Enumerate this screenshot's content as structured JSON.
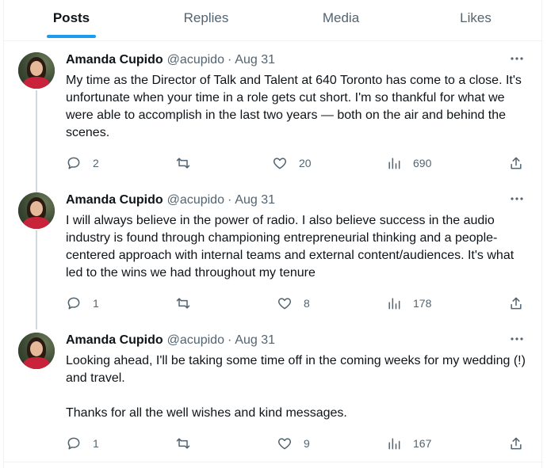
{
  "tabs": [
    {
      "label": "Posts",
      "active": true
    },
    {
      "label": "Replies",
      "active": false
    },
    {
      "label": "Media",
      "active": false
    },
    {
      "label": "Likes",
      "active": false
    }
  ],
  "posts": [
    {
      "author": "Amanda Cupido",
      "handle": "@acupido",
      "date": "Aug 31",
      "text": "My time as the Director of Talk and Talent at 640 Toronto has come to a close. It's unfortunate when your time in a role gets cut short. I'm so thankful for what we were able to accomplish in the last two years — both on the air and behind the scenes.",
      "replies": "2",
      "reposts": "",
      "likes": "20",
      "views": "690"
    },
    {
      "author": "Amanda Cupido",
      "handle": "@acupido",
      "date": "Aug 31",
      "text": "I will always believe in the power of radio. I also believe success in the audio industry is found through championing entrepreneurial thinking and a people-centered approach with internal teams and external content/audiences. It's what led to the wins we had throughout my tenure",
      "replies": "1",
      "reposts": "",
      "likes": "8",
      "views": "178"
    },
    {
      "author": "Amanda Cupido",
      "handle": "@acupido",
      "date": "Aug 31",
      "text": "Looking ahead, I'll be taking some time off in the coming weeks for my wedding (!) and travel.\n\nThanks for all the well wishes and kind messages.",
      "replies": "1",
      "reposts": "",
      "likes": "9",
      "views": "167"
    }
  ],
  "separators": "·",
  "colors": {
    "accent": "#1d9bf0",
    "text": "#0f1419",
    "muted": "#536471",
    "border": "#eff3f4"
  },
  "icons": [
    "more-icon",
    "reply-icon",
    "repost-icon",
    "like-icon",
    "views-icon",
    "share-icon"
  ]
}
